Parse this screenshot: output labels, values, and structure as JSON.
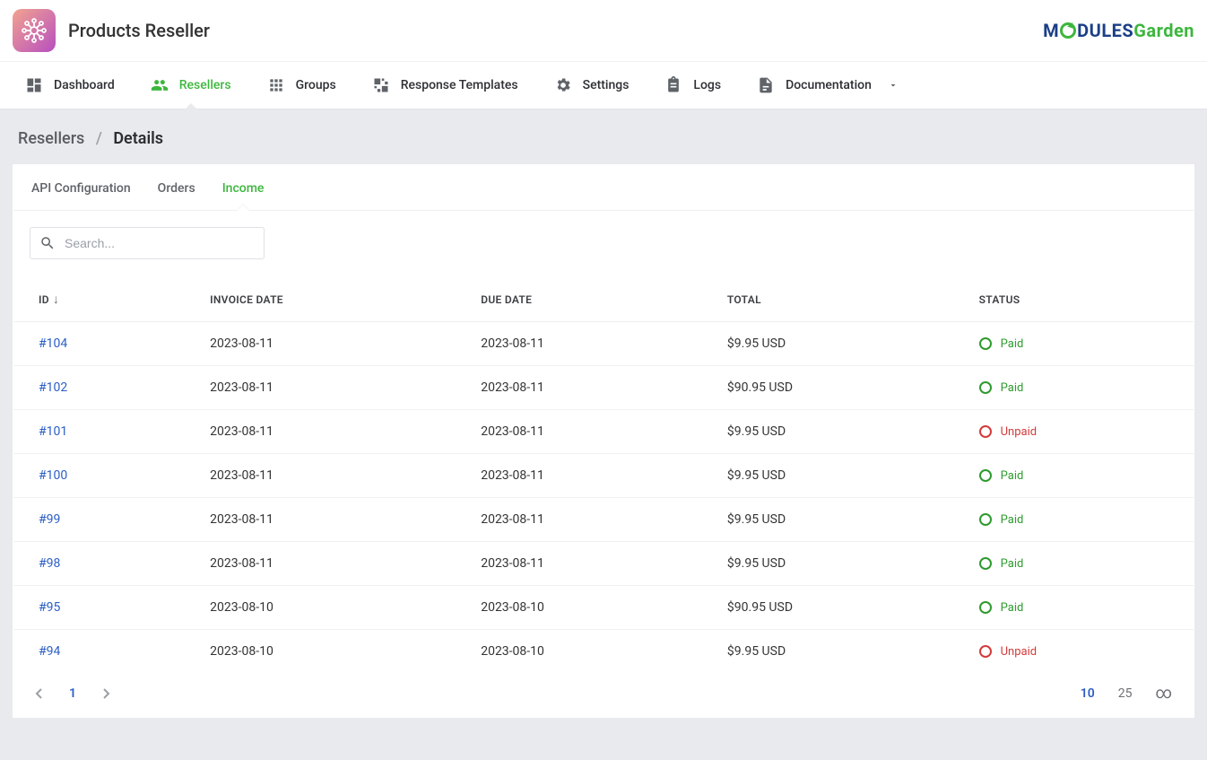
{
  "header": {
    "title": "Products Reseller"
  },
  "nav": {
    "items": [
      {
        "label": "Dashboard",
        "icon": "dashboard-icon"
      },
      {
        "label": "Resellers",
        "icon": "people-icon",
        "active": true
      },
      {
        "label": "Groups",
        "icon": "grid-icon"
      },
      {
        "label": "Response Templates",
        "icon": "templates-icon"
      },
      {
        "label": "Settings",
        "icon": "gear-icon"
      },
      {
        "label": "Logs",
        "icon": "clipboard-icon"
      },
      {
        "label": "Documentation",
        "icon": "doc-icon",
        "submenu": true
      }
    ]
  },
  "breadcrumb": {
    "parent": "Resellers",
    "current": "Details"
  },
  "tabs": {
    "items": [
      {
        "label": "API Configuration"
      },
      {
        "label": "Orders"
      },
      {
        "label": "Income",
        "active": true
      }
    ]
  },
  "search": {
    "placeholder": "Search..."
  },
  "table": {
    "headers": {
      "id": "ID",
      "invoice_date": "INVOICE DATE",
      "due_date": "DUE DATE",
      "total": "TOTAL",
      "status": "STATUS"
    },
    "rows": [
      {
        "id": "#104",
        "invoice_date": "2023-08-11",
        "due_date": "2023-08-11",
        "total": "$9.95 USD",
        "status": "Paid",
        "status_key": "paid"
      },
      {
        "id": "#102",
        "invoice_date": "2023-08-11",
        "due_date": "2023-08-11",
        "total": "$90.95 USD",
        "status": "Paid",
        "status_key": "paid"
      },
      {
        "id": "#101",
        "invoice_date": "2023-08-11",
        "due_date": "2023-08-11",
        "total": "$9.95 USD",
        "status": "Unpaid",
        "status_key": "unpaid"
      },
      {
        "id": "#100",
        "invoice_date": "2023-08-11",
        "due_date": "2023-08-11",
        "total": "$9.95 USD",
        "status": "Paid",
        "status_key": "paid"
      },
      {
        "id": "#99",
        "invoice_date": "2023-08-11",
        "due_date": "2023-08-11",
        "total": "$9.95 USD",
        "status": "Paid",
        "status_key": "paid"
      },
      {
        "id": "#98",
        "invoice_date": "2023-08-11",
        "due_date": "2023-08-11",
        "total": "$9.95 USD",
        "status": "Paid",
        "status_key": "paid"
      },
      {
        "id": "#95",
        "invoice_date": "2023-08-10",
        "due_date": "2023-08-10",
        "total": "$90.95 USD",
        "status": "Paid",
        "status_key": "paid"
      },
      {
        "id": "#94",
        "invoice_date": "2023-08-10",
        "due_date": "2023-08-10",
        "total": "$9.95 USD",
        "status": "Unpaid",
        "status_key": "unpaid"
      }
    ]
  },
  "pagination": {
    "page": "1",
    "per_page_options": [
      {
        "label": "10",
        "active": true
      },
      {
        "label": "25"
      },
      {
        "label": "∞"
      }
    ]
  }
}
